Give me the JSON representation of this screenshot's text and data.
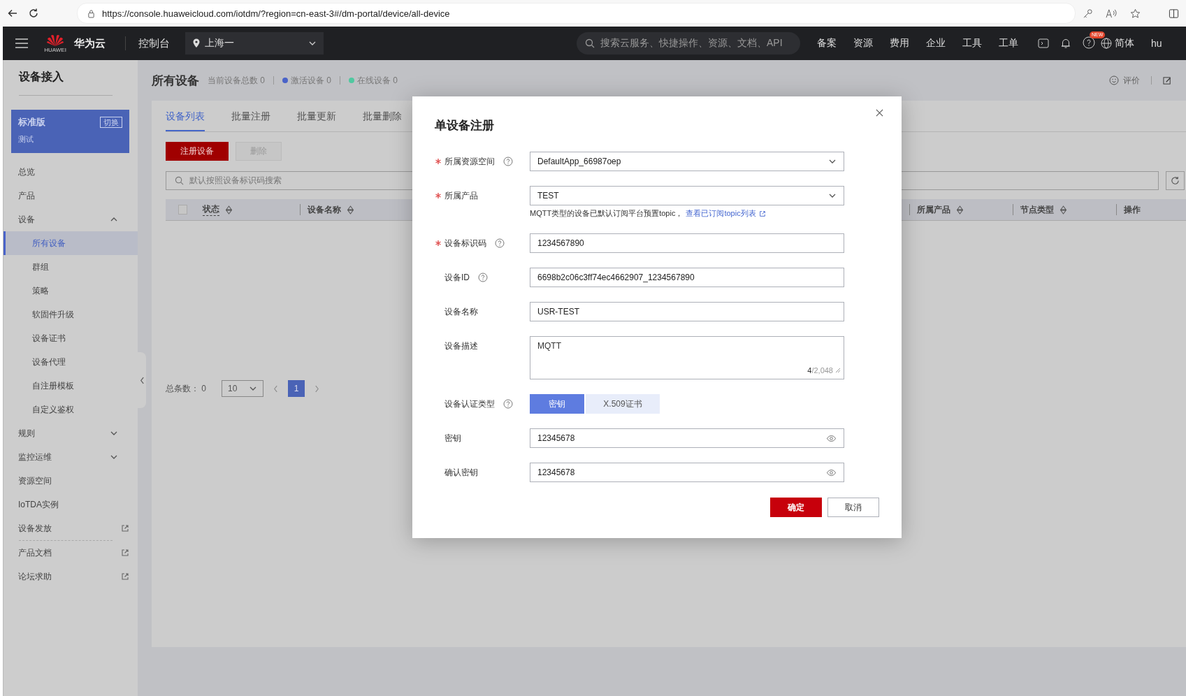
{
  "browser": {
    "url": "https://console.huaweicloud.com/iotdm/?region=cn-east-3#/dm-portal/device/all-device"
  },
  "top_nav": {
    "logo_text": "HUAWEI",
    "brand": "华为云",
    "console": "控制台",
    "region": "上海一",
    "search_placeholder": "搜索云服务、快捷操作、资源、文档、API",
    "links": [
      "备案",
      "资源",
      "费用",
      "企业",
      "工具",
      "工单"
    ],
    "new_badge": "NEW",
    "language": "简体",
    "user": "hu"
  },
  "sidebar": {
    "title": "设备接入",
    "edition": {
      "name": "标准版",
      "switch": "切换",
      "instance": "测试"
    },
    "items": [
      {
        "label": "总览",
        "kind": "link",
        "selected": false
      },
      {
        "label": "产品",
        "kind": "link",
        "selected": false
      },
      {
        "label": "设备",
        "kind": "group",
        "expanded": true,
        "selected": false,
        "children": [
          {
            "label": "所有设备",
            "selected": true
          },
          {
            "label": "群组",
            "selected": false
          },
          {
            "label": "策略",
            "selected": false
          },
          {
            "label": "软固件升级",
            "selected": false
          },
          {
            "label": "设备证书",
            "selected": false
          },
          {
            "label": "设备代理",
            "selected": false
          },
          {
            "label": "自注册模板",
            "selected": false
          },
          {
            "label": "自定义鉴权",
            "selected": false
          }
        ]
      },
      {
        "label": "规则",
        "kind": "group",
        "expanded": false,
        "selected": false
      },
      {
        "label": "监控运维",
        "kind": "group",
        "expanded": false,
        "selected": false
      },
      {
        "label": "资源空间",
        "kind": "link",
        "selected": false
      },
      {
        "label": "IoTDA实例",
        "kind": "link",
        "selected": false
      },
      {
        "label": "设备发放",
        "kind": "external",
        "selected": false
      }
    ],
    "footer_links": [
      {
        "label": "产品文档",
        "kind": "external"
      },
      {
        "label": "论坛求助",
        "kind": "external"
      }
    ]
  },
  "page": {
    "title": "所有设备",
    "stats": [
      {
        "label": "当前设备总数",
        "value": "0"
      },
      {
        "label": "激活设备",
        "value": "0",
        "color": "#4a63c8"
      },
      {
        "label": "在线设备",
        "value": "0",
        "color": "#50c8a0"
      }
    ],
    "feedback": "评价",
    "tabs": [
      {
        "label": "设备列表",
        "selected": true
      },
      {
        "label": "批量注册",
        "selected": false
      },
      {
        "label": "批量更新",
        "selected": false
      },
      {
        "label": "批量删除",
        "selected": false
      }
    ],
    "actions": [
      {
        "label": "注册设备",
        "kind": "primary",
        "disabled": false
      },
      {
        "label": "删除",
        "kind": "default",
        "disabled": true
      }
    ],
    "search_placeholder": "默认按照设备标识码搜索",
    "table": {
      "select_all": {
        "checked": false
      },
      "columns": [
        {
          "label": "状态",
          "sortable": true
        },
        {
          "label": "设备名称",
          "sortable": true
        },
        {
          "label": "所属产品",
          "sortable": true
        },
        {
          "label": "节点类型",
          "sortable": true
        },
        {
          "label": "操作",
          "sortable": false
        }
      ]
    },
    "pagination": {
      "total_label": "总条数：",
      "total": "0",
      "page_size": "10",
      "pages": [
        {
          "label": "1",
          "selected": true
        }
      ]
    }
  },
  "dialog": {
    "title": "单设备注册",
    "fields": [
      {
        "label": "所属资源空间",
        "required": true,
        "help": true,
        "kind": "select",
        "value": "DefaultApp_66987oep"
      },
      {
        "label": "所属产品",
        "required": true,
        "help": false,
        "kind": "select",
        "value": "TEST",
        "hint": {
          "text": "MQTT类型的设备已默认订阅平台预置topic，",
          "link": "查看已订阅topic列表"
        }
      },
      {
        "label": "设备标识码",
        "required": true,
        "help": true,
        "kind": "input",
        "value": "1234567890"
      },
      {
        "label": "设备ID",
        "required": false,
        "help": true,
        "kind": "input",
        "value": "6698b2c06c3ff74ec4662907_1234567890"
      },
      {
        "label": "设备名称",
        "required": false,
        "help": false,
        "kind": "input",
        "value": "USR-TEST"
      },
      {
        "label": "设备描述",
        "required": false,
        "help": false,
        "kind": "textarea",
        "value": "MQTT",
        "count": "4",
        "max": "/2,048"
      },
      {
        "label": "设备认证类型",
        "required": false,
        "help": true,
        "kind": "segmented",
        "options": [
          {
            "label": "密钥",
            "selected": true
          },
          {
            "label": "X.509证书",
            "selected": false
          }
        ]
      },
      {
        "label": "密钥",
        "required": false,
        "help": false,
        "kind": "password",
        "value": "12345678"
      },
      {
        "label": "确认密钥",
        "required": false,
        "help": false,
        "kind": "password",
        "value": "12345678"
      }
    ],
    "buttons": [
      {
        "label": "确定",
        "kind": "primary"
      },
      {
        "label": "取消",
        "kind": "default"
      }
    ]
  }
}
